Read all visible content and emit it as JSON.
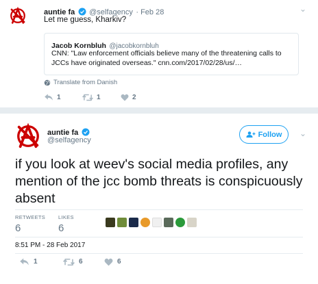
{
  "tweet1": {
    "name": "auntie fa",
    "handle": "@selfagency",
    "date": "· Feb 28",
    "text": "Let me guess, Kharkiv?",
    "quoted": {
      "name": "Jacob Kornbluh",
      "handle": "@jacobkornbluh",
      "text": "CNN: \"Law enforcement officials believe many of the threatening calls to JCCs have originated overseas.\" cnn.com/2017/02/28/us/…"
    },
    "translate": "Translate from Danish",
    "actions": {
      "replies": "1",
      "retweets": "1",
      "likes": "2"
    }
  },
  "tweet2": {
    "name": "auntie fa",
    "handle": "@selfagency",
    "follow_label": "Follow",
    "text": "if you look at weev's social media profiles, any mention of the jcc bomb threats is conspicuously absent",
    "stats": {
      "retweets_label": "RETWEETS",
      "retweets": "6",
      "likes_label": "LIKES",
      "likes": "6"
    },
    "timestamp": "8:51 PM - 28 Feb 2017",
    "actions": {
      "replies": "1",
      "retweets": "6",
      "likes": "6"
    }
  },
  "colors": {
    "brand_red": "#cc0000",
    "twitter_blue": "#1da1f2",
    "muted": "#657786",
    "separator": "#e6ecf0"
  },
  "icons": [
    "anarchy-avatar-icon",
    "verified-icon",
    "chevron-down-icon",
    "globe-icon",
    "reply-icon",
    "retweet-icon",
    "heart-icon",
    "follow-person-icon"
  ]
}
